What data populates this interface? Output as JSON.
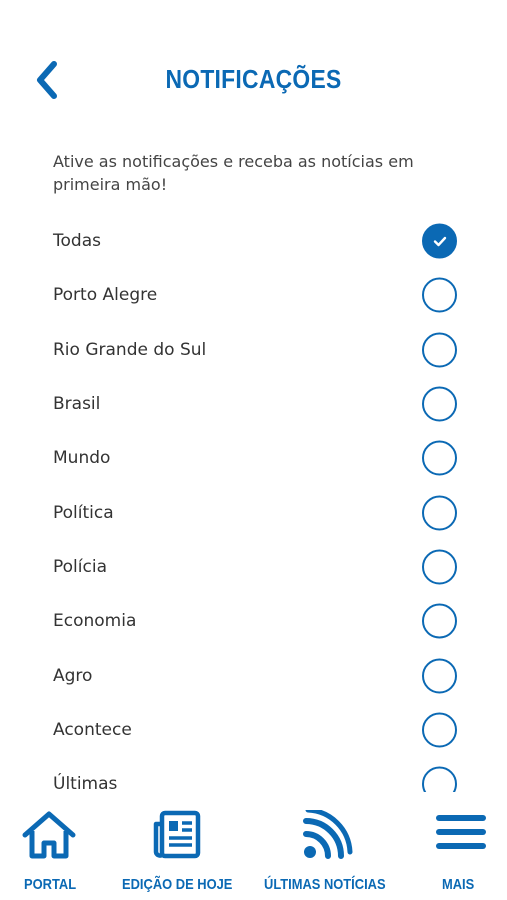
{
  "header": {
    "title": "NOTIFICAÇÕES",
    "back_icon": "chevron-left-icon"
  },
  "intro": {
    "text": "Ative as notificações e receba as notícias em primeira mão!"
  },
  "options": [
    {
      "label": "Todas",
      "checked": true
    },
    {
      "label": "Porto Alegre",
      "checked": false
    },
    {
      "label": "Rio Grande do Sul",
      "checked": false
    },
    {
      "label": "Brasil",
      "checked": false
    },
    {
      "label": "Mundo",
      "checked": false
    },
    {
      "label": "Política",
      "checked": false
    },
    {
      "label": "Polícia",
      "checked": false
    },
    {
      "label": "Economia",
      "checked": false
    },
    {
      "label": "Agro",
      "checked": false
    },
    {
      "label": "Acontece",
      "checked": false
    },
    {
      "label": "Últimas",
      "checked": false
    }
  ],
  "bottom_nav": {
    "items": [
      {
        "label": "PORTAL",
        "icon": "home-icon"
      },
      {
        "label": "EDIÇÃO DE HOJE",
        "icon": "newspaper-icon"
      },
      {
        "label": "ÚLTIMAS NOTÍCIAS",
        "icon": "rss-icon"
      },
      {
        "label": "MAIS",
        "icon": "menu-icon"
      }
    ]
  },
  "colors": {
    "accent": "#0b69b4",
    "text": "#333333",
    "background": "#ffffff"
  }
}
